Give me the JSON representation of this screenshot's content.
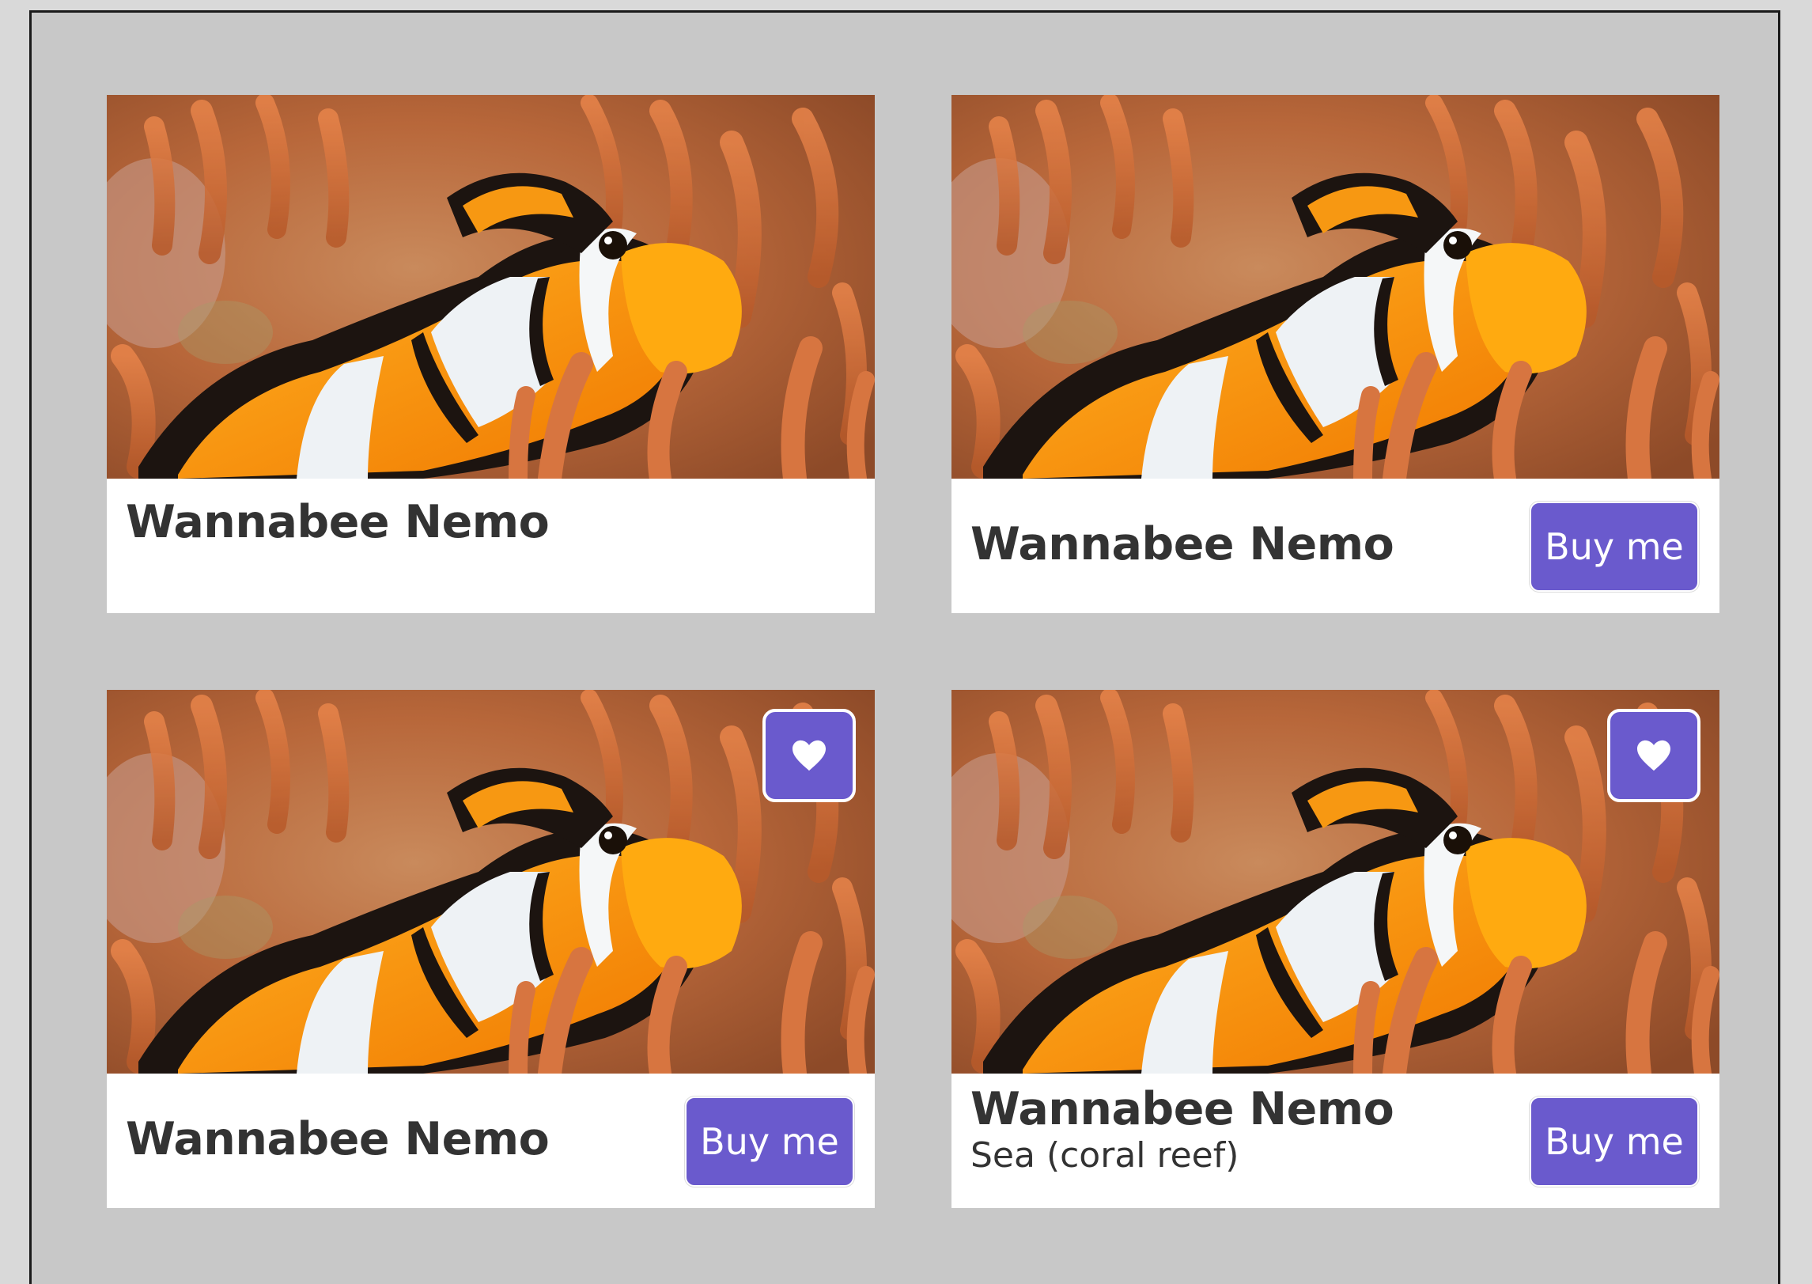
{
  "cards": [
    {
      "title": "Wannabee Nemo"
    },
    {
      "title": "Wannabee Nemo",
      "buy_label": "Buy me"
    },
    {
      "title": "Wannabee Nemo",
      "buy_label": "Buy me",
      "favorite_icon": "heart-icon"
    },
    {
      "title": "Wannabee Nemo",
      "subtitle": "Sea (coral reef)",
      "buy_label": "Buy me",
      "favorite_icon": "heart-icon"
    }
  ],
  "colors": {
    "accent": "#6a5acd",
    "background": "#c8c8c8",
    "card": "#ffffff",
    "text": "#333333"
  }
}
